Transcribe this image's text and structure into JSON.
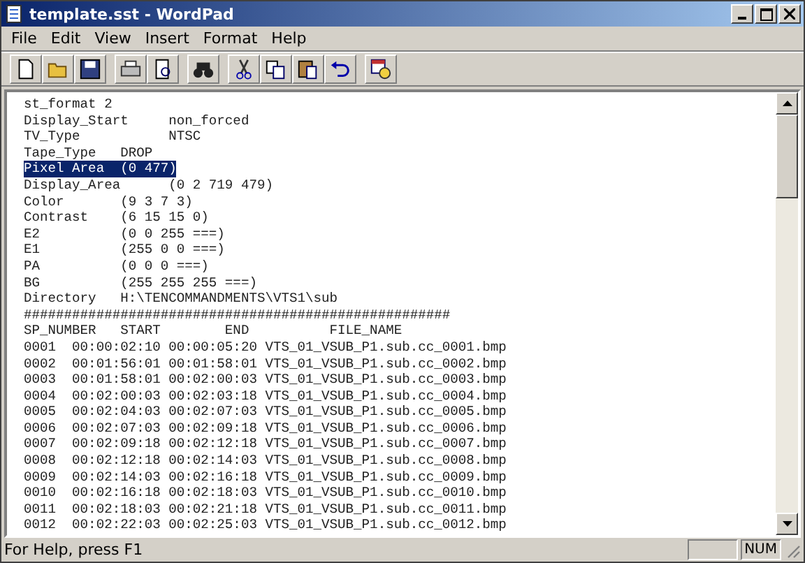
{
  "window": {
    "title": "template.sst - WordPad"
  },
  "menu": [
    "File",
    "Edit",
    "View",
    "Insert",
    "Format",
    "Help"
  ],
  "document": {
    "lines": [
      {
        "text": "st_format 2",
        "selected": false
      },
      {
        "text": "Display_Start     non_forced",
        "selected": false
      },
      {
        "text": "TV_Type           NTSC",
        "selected": false
      },
      {
        "text": "Tape_Type   DROP",
        "selected": false
      },
      {
        "text": "Pixel Area  (0 477)",
        "selected": true
      },
      {
        "text": "Display_Area      (0 2 719 479)",
        "selected": false
      },
      {
        "text": "Color       (9 3 7 3)",
        "selected": false
      },
      {
        "text": "Contrast    (6 15 15 0)",
        "selected": false
      },
      {
        "text": "E2          (0 0 255 ===)",
        "selected": false
      },
      {
        "text": "E1          (255 0 0 ===)",
        "selected": false
      },
      {
        "text": "PA          (0 0 0 ===)",
        "selected": false
      },
      {
        "text": "BG          (255 255 255 ===)",
        "selected": false
      },
      {
        "text": "Directory   H:\\TENCOMMANDMENTS\\VTS1\\sub",
        "selected": false
      },
      {
        "text": "#####################################################",
        "selected": false
      },
      {
        "text": "SP_NUMBER   START        END          FILE_NAME",
        "selected": false
      },
      {
        "text": "0001  00:00:02:10 00:00:05:20 VTS_01_VSUB_P1.sub.cc_0001.bmp",
        "selected": false
      },
      {
        "text": "0002  00:01:56:01 00:01:58:01 VTS_01_VSUB_P1.sub.cc_0002.bmp",
        "selected": false
      },
      {
        "text": "0003  00:01:58:01 00:02:00:03 VTS_01_VSUB_P1.sub.cc_0003.bmp",
        "selected": false
      },
      {
        "text": "0004  00:02:00:03 00:02:03:18 VTS_01_VSUB_P1.sub.cc_0004.bmp",
        "selected": false
      },
      {
        "text": "0005  00:02:04:03 00:02:07:03 VTS_01_VSUB_P1.sub.cc_0005.bmp",
        "selected": false
      },
      {
        "text": "0006  00:02:07:03 00:02:09:18 VTS_01_VSUB_P1.sub.cc_0006.bmp",
        "selected": false
      },
      {
        "text": "0007  00:02:09:18 00:02:12:18 VTS_01_VSUB_P1.sub.cc_0007.bmp",
        "selected": false
      },
      {
        "text": "0008  00:02:12:18 00:02:14:03 VTS_01_VSUB_P1.sub.cc_0008.bmp",
        "selected": false
      },
      {
        "text": "0009  00:02:14:03 00:02:16:18 VTS_01_VSUB_P1.sub.cc_0009.bmp",
        "selected": false
      },
      {
        "text": "0010  00:02:16:18 00:02:18:03 VTS_01_VSUB_P1.sub.cc_0010.bmp",
        "selected": false
      },
      {
        "text": "0011  00:02:18:03 00:02:21:18 VTS_01_VSUB_P1.sub.cc_0011.bmp",
        "selected": false
      },
      {
        "text": "0012  00:02:22:03 00:02:25:03 VTS_01_VSUB_P1.sub.cc_0012.bmp",
        "selected": false
      }
    ]
  },
  "status_bar": {
    "text": "For Help, press F1",
    "indicator": "NUM"
  }
}
